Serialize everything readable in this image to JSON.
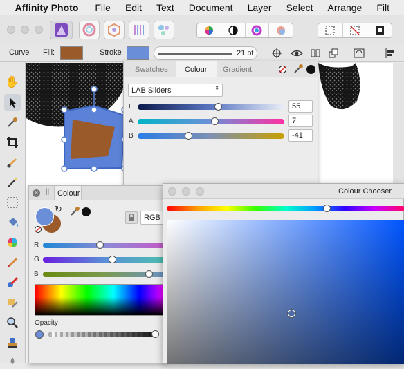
{
  "menubar": {
    "items": [
      "Affinity Photo",
      "File",
      "Edit",
      "Text",
      "Document",
      "Layer",
      "Select",
      "Arrange",
      "Filt"
    ]
  },
  "context": {
    "tool_name": "Curve",
    "fill_label": "Fill:",
    "fill_color": "#9a5a2a",
    "stroke_label": "Stroke",
    "stroke_color": "#6a8fd8",
    "stroke_width": "21 pt"
  },
  "colour_panel_top": {
    "tabs": [
      "Swatches",
      "Colour",
      "Gradient"
    ],
    "active_tab": "Colour",
    "mode": "LAB Sliders",
    "sliders": [
      {
        "label": "L",
        "value": "55"
      },
      {
        "label": "A",
        "value": "7"
      },
      {
        "label": "B",
        "value": "-41"
      }
    ]
  },
  "colour_panel_float": {
    "title": "Colour",
    "model": "RGB",
    "sliders": [
      {
        "label": "R"
      },
      {
        "label": "G"
      },
      {
        "label": "B"
      }
    ],
    "opacity_label": "Opacity"
  },
  "colour_chooser": {
    "title": "Colour Chooser"
  },
  "colors": {
    "primary": "#6a8fd8",
    "secondary": "#9a5a2a",
    "selection": "#5b82d6"
  }
}
